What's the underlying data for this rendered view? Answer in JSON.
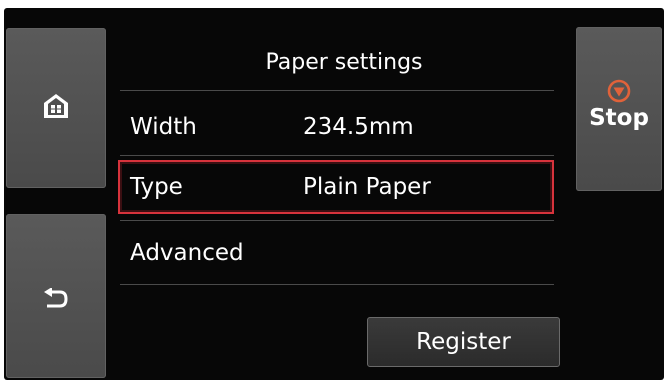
{
  "screen": {
    "title": "Paper settings"
  },
  "left_buttons": {
    "home_icon": "home-icon",
    "back_icon": "back-arrow-icon"
  },
  "right_buttons": {
    "stop_label": "Stop",
    "stop_icon": "stop-icon",
    "stop_icon_color": "#e0623a"
  },
  "settings": [
    {
      "label": "Width",
      "value": "234.5mm"
    },
    {
      "label": "Type",
      "value": "Plain Paper",
      "selected": true
    },
    {
      "label": "Advanced",
      "value": ""
    }
  ],
  "register_label": "Register",
  "colors": {
    "selection_border": "#d7333c",
    "background": "#070707",
    "button": "#555555"
  }
}
